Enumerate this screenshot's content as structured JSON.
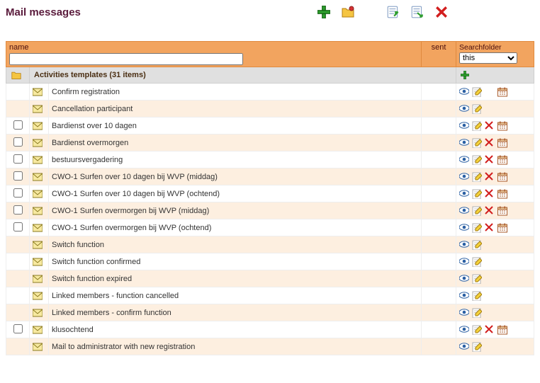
{
  "title": "Mail messages",
  "header": {
    "name_label": "name",
    "sent_label": "sent",
    "searchfolder_label": "Searchfolder",
    "searchfolder_value": "this"
  },
  "folder": {
    "label": "Activities templates (31 items)"
  },
  "rows": [
    {
      "chk": null,
      "name": "Confirm registration",
      "actions": [
        "view",
        "edit",
        "",
        "schedule"
      ]
    },
    {
      "chk": null,
      "name": "Cancellation participant",
      "actions": [
        "view",
        "edit"
      ]
    },
    {
      "chk": false,
      "name": "Bardienst over 10 dagen",
      "actions": [
        "view",
        "edit",
        "delete",
        "schedule"
      ]
    },
    {
      "chk": false,
      "name": "Bardienst overmorgen",
      "actions": [
        "view",
        "edit",
        "delete",
        "schedule"
      ]
    },
    {
      "chk": false,
      "name": "bestuursvergadering",
      "actions": [
        "view",
        "edit",
        "delete",
        "schedule"
      ]
    },
    {
      "chk": false,
      "name": "CWO-1 Surfen over 10 dagen bij WVP (middag)",
      "actions": [
        "view",
        "edit",
        "delete",
        "schedule"
      ]
    },
    {
      "chk": false,
      "name": "CWO-1 Surfen over 10 dagen bij WVP (ochtend)",
      "actions": [
        "view",
        "edit",
        "delete",
        "schedule"
      ]
    },
    {
      "chk": false,
      "name": "CWO-1 Surfen overmorgen bij WVP (middag)",
      "actions": [
        "view",
        "edit",
        "delete",
        "schedule"
      ]
    },
    {
      "chk": false,
      "name": "CWO-1 Surfen overmorgen bij WVP (ochtend)",
      "actions": [
        "view",
        "edit",
        "delete",
        "schedule"
      ]
    },
    {
      "chk": null,
      "name": "Switch function",
      "actions": [
        "view",
        "edit"
      ]
    },
    {
      "chk": null,
      "name": "Switch function confirmed",
      "actions": [
        "view",
        "edit"
      ]
    },
    {
      "chk": null,
      "name": "Switch function expired",
      "actions": [
        "view",
        "edit"
      ]
    },
    {
      "chk": null,
      "name": "Linked members - function cancelled",
      "actions": [
        "view",
        "edit"
      ]
    },
    {
      "chk": null,
      "name": "Linked members - confirm function",
      "actions": [
        "view",
        "edit"
      ]
    },
    {
      "chk": false,
      "name": "klusochtend",
      "actions": [
        "view",
        "edit",
        "delete",
        "schedule"
      ]
    },
    {
      "chk": null,
      "name": "Mail to administrator with new registration",
      "actions": [
        "view",
        "edit"
      ]
    }
  ]
}
